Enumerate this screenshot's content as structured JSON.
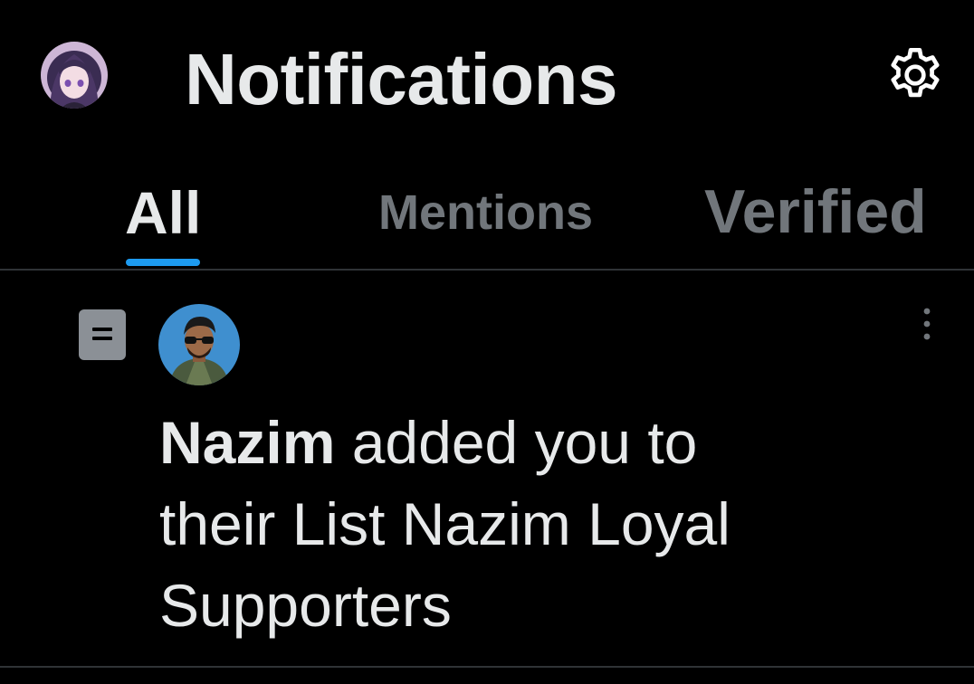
{
  "header": {
    "title": "Notifications",
    "avatar_icon": "user-avatar-anime",
    "settings_icon": "gear-icon"
  },
  "tabs": [
    {
      "label": "All",
      "active": true
    },
    {
      "label": "Mentions",
      "active": false
    },
    {
      "label": "Verified",
      "active": false
    }
  ],
  "notification": {
    "type_icon": "list-icon",
    "avatar_icon": "user-avatar-nazim",
    "more_icon": "more-vertical-icon",
    "actor": "Nazim",
    "message": " added you to their List Nazim Loyal Supporters"
  },
  "colors": {
    "background": "#000000",
    "text_primary": "#e7e9ea",
    "text_secondary": "#71767b",
    "accent": "#1d9bf0",
    "divider": "#2f3336"
  }
}
